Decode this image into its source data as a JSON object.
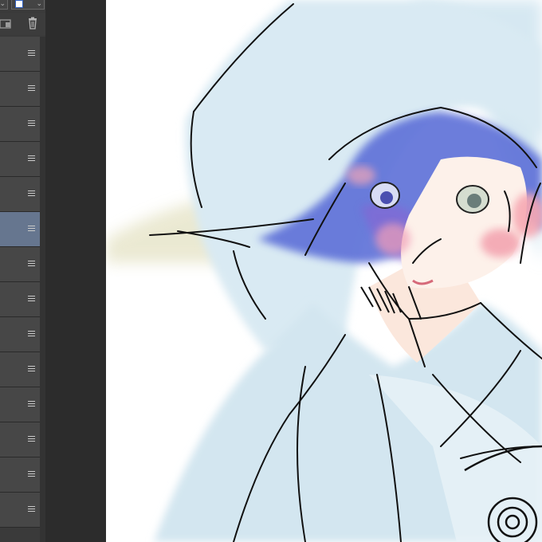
{
  "app": {
    "panel": "layers",
    "selected_layer_index": 5,
    "layer_count": 13
  },
  "toolbar": {
    "icons": [
      "new-folder-icon",
      "trash-icon"
    ],
    "swatch_color": "#3060c0"
  },
  "layers": [
    {
      "selected": false
    },
    {
      "selected": false
    },
    {
      "selected": false
    },
    {
      "selected": false
    },
    {
      "selected": false
    },
    {
      "selected": true
    },
    {
      "selected": false
    },
    {
      "selected": false
    },
    {
      "selected": false
    },
    {
      "selected": false
    },
    {
      "selected": false
    },
    {
      "selected": false
    },
    {
      "selected": false
    },
    {
      "selected": false
    }
  ],
  "colors": {
    "panel_bg": "#3a3a3a",
    "layer_bg": "#474747",
    "layer_selected": "#66768f",
    "canvas_bg": "#ffffff",
    "robe_blue": "#cfe4ee",
    "hair_blue": "#5b6fd6",
    "blush": "#f3a0ad"
  }
}
